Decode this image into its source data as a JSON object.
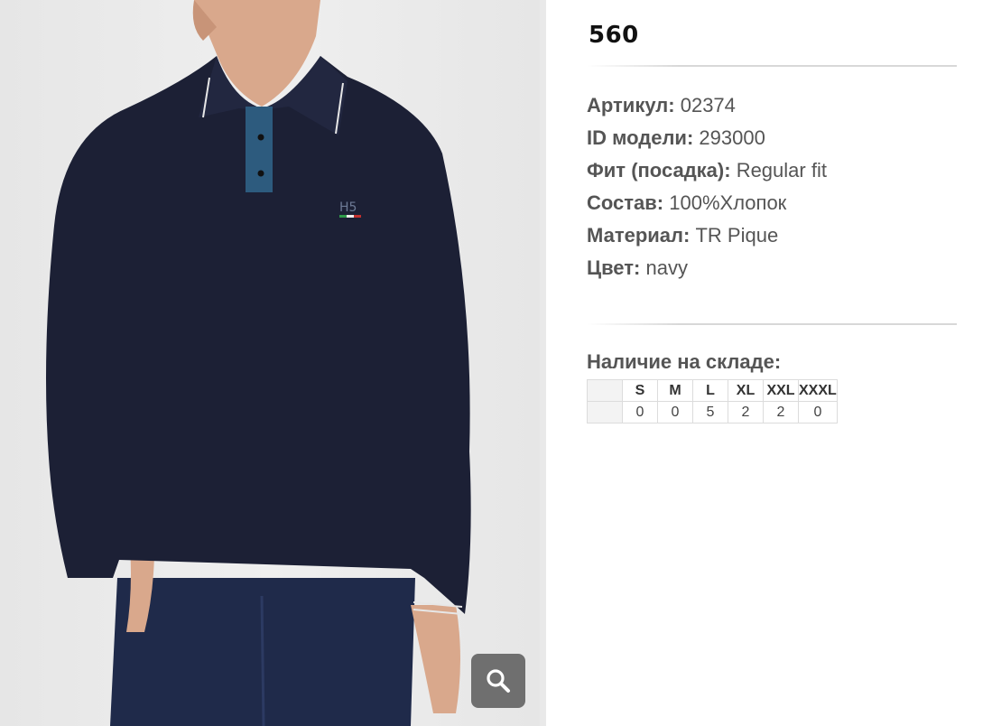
{
  "product": {
    "title": "560",
    "image_alt": "Navy long sleeve polo shirt"
  },
  "attributes": [
    {
      "label": "Артикул:",
      "value": "02374"
    },
    {
      "label": "ID модели:",
      "value": "293000"
    },
    {
      "label": "Фит (посадка):",
      "value": "Regular fit"
    },
    {
      "label": "Состав:",
      "value": "100%Хлопок"
    },
    {
      "label": "Материал:",
      "value": "TR Pique"
    },
    {
      "label": "Цвет:",
      "value": "navy"
    }
  ],
  "stock": {
    "title": "Наличие на складе:",
    "sizes": [
      "S",
      "M",
      "L",
      "XL",
      "XXL",
      "XXXL"
    ],
    "quantities": [
      "0",
      "0",
      "5",
      "2",
      "2",
      "0"
    ]
  },
  "icons": {
    "zoom": "magnifier-icon"
  },
  "colors": {
    "shirt": "#1c2035",
    "jeans": "#1f2a4a",
    "zoom_button": "#6f6f6f"
  }
}
